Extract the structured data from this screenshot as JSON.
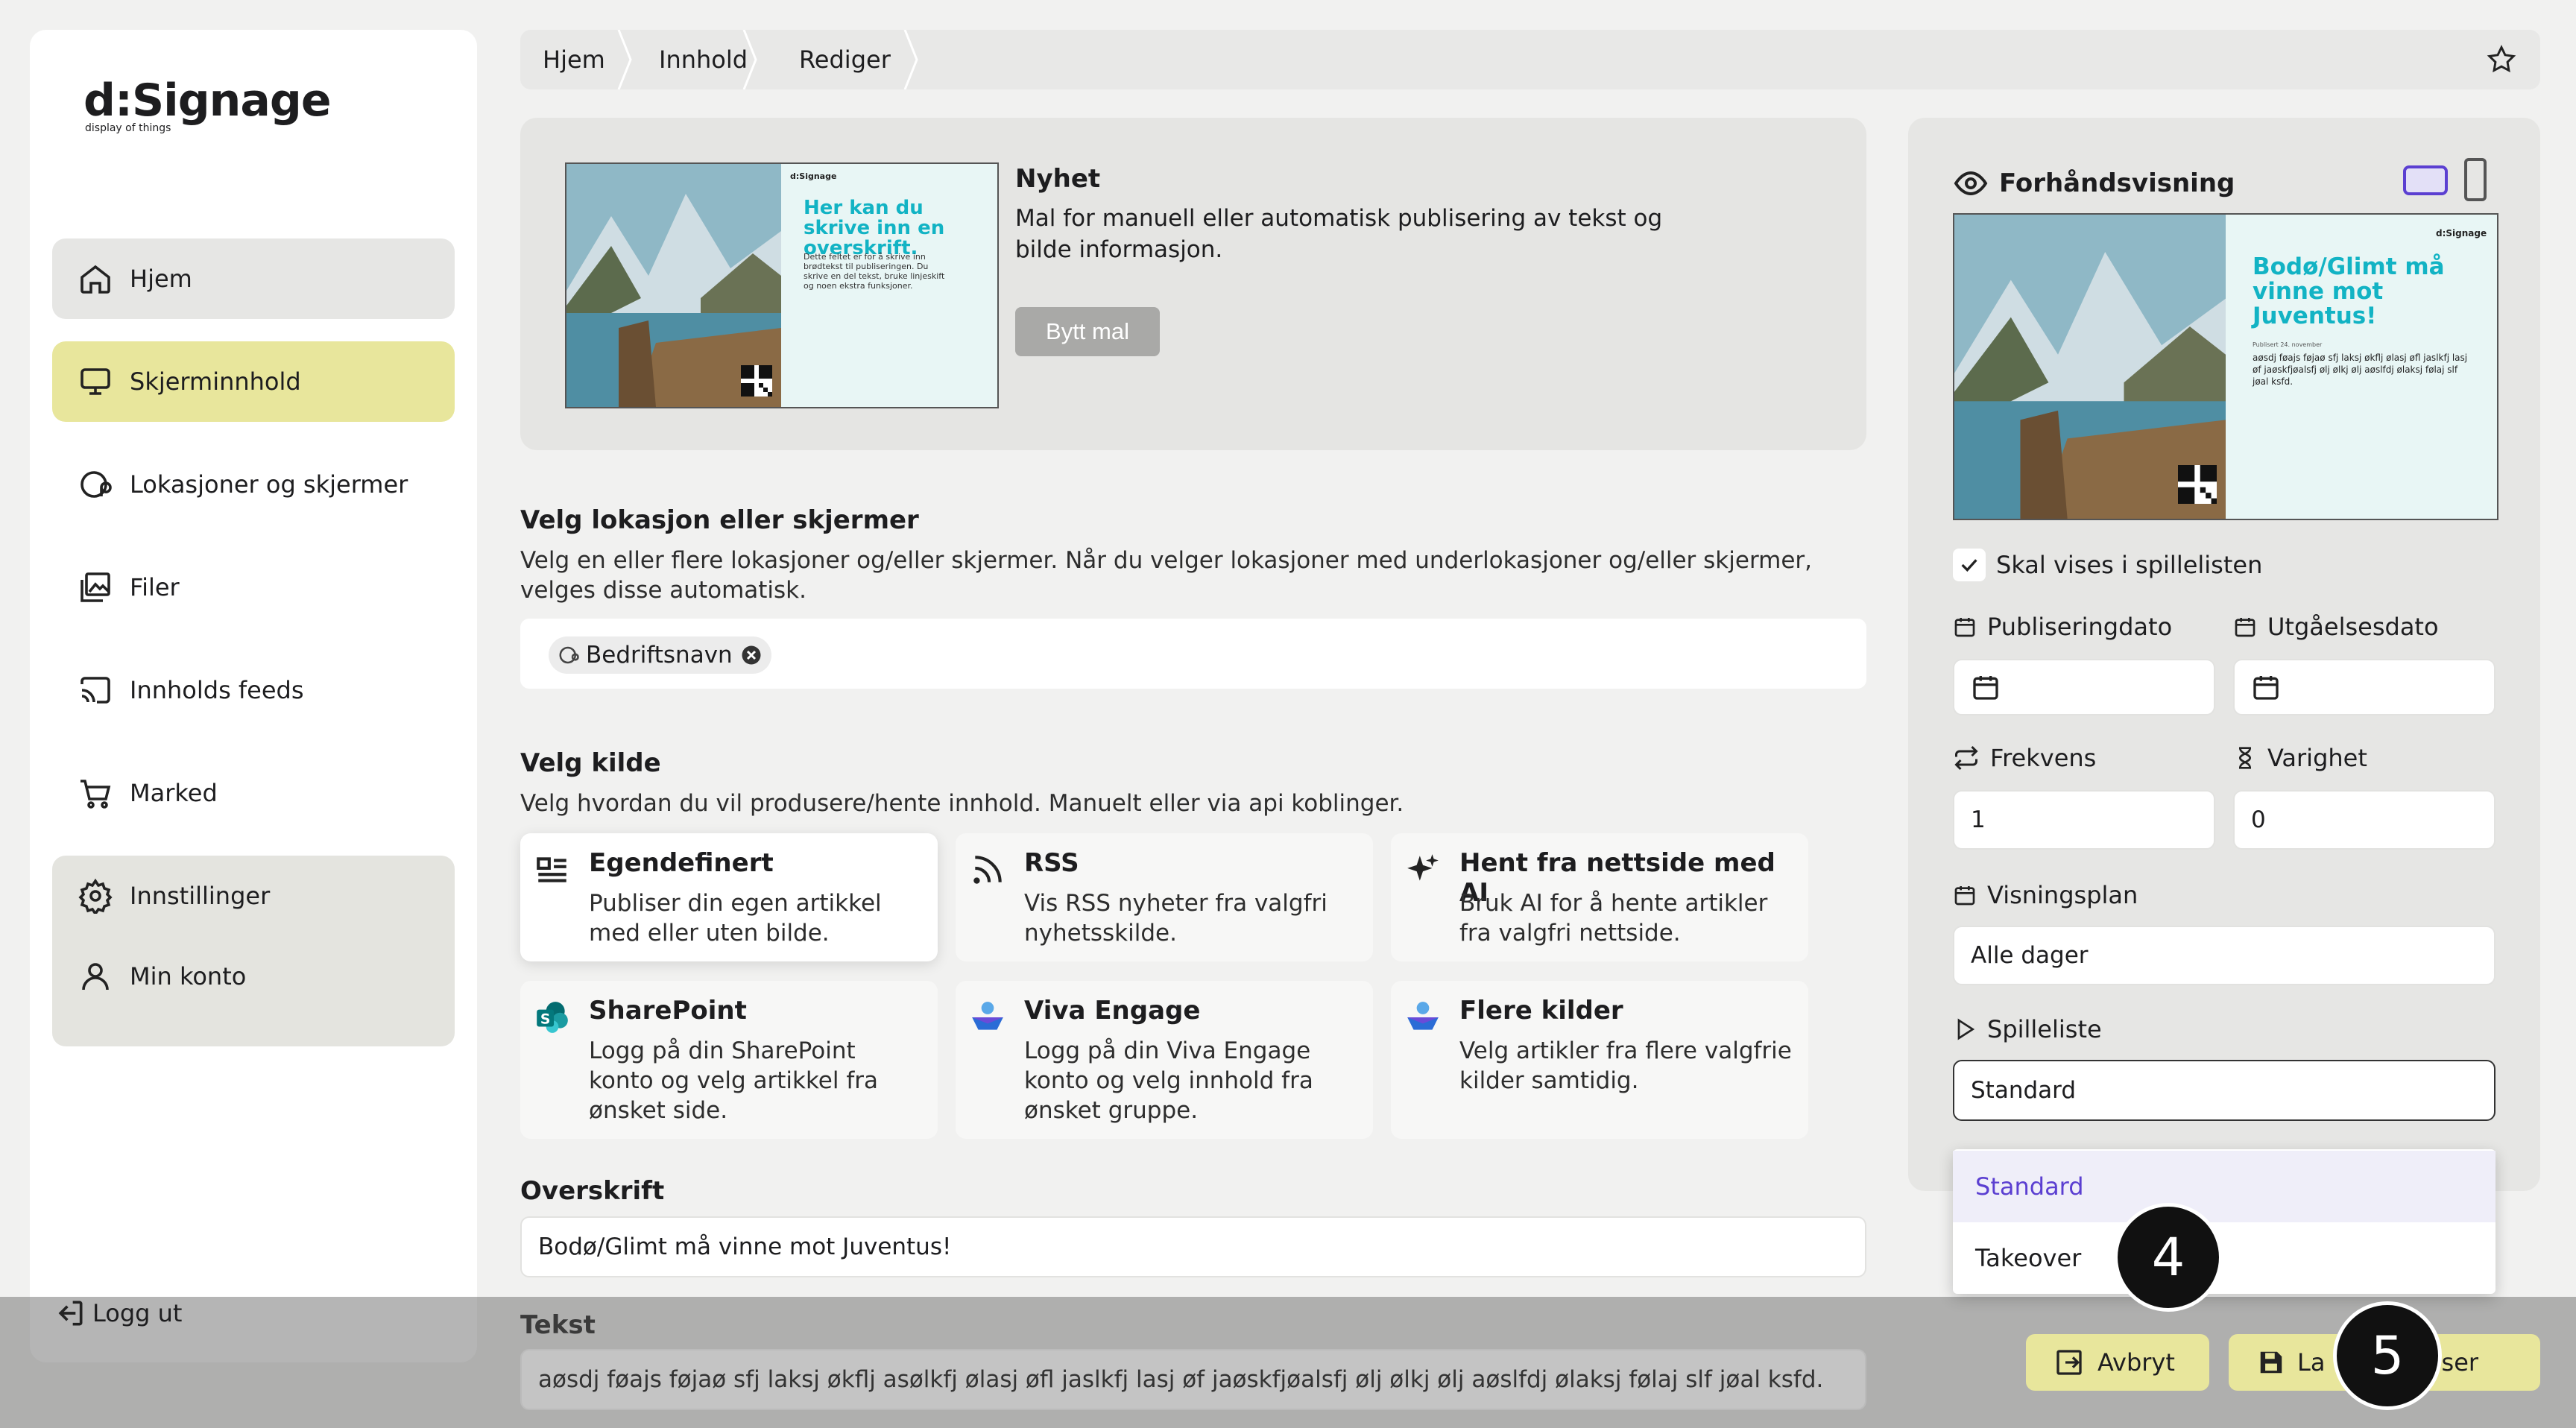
{
  "app": {
    "logo": "d:Signage",
    "logo_sub": "display of things"
  },
  "sidebar": {
    "items": [
      {
        "label": "Hjem",
        "icon": "home-icon"
      },
      {
        "label": "Skjerminnhold",
        "icon": "monitor-icon"
      },
      {
        "label": "Lokasjoner og skjermer",
        "icon": "location-icon"
      },
      {
        "label": "Filer",
        "icon": "images-icon"
      },
      {
        "label": "Innholds feeds",
        "icon": "cast-icon"
      },
      {
        "label": "Marked",
        "icon": "cart-icon"
      },
      {
        "label": "Innstillinger",
        "icon": "gear-icon"
      },
      {
        "label": "Min konto",
        "icon": "user-icon"
      }
    ],
    "logout": "Logg ut"
  },
  "breadcrumb": [
    "Hjem",
    "Innhold",
    "Rediger"
  ],
  "template": {
    "title": "Nyhet",
    "description": "Mal for manuell eller automatisk publisering av tekst og bilde informasjon.",
    "button": "Bytt mal",
    "thumb_heading": "Her kan du skrive inn en overskrift.",
    "thumb_body": "Dette feltet er for å skrive inn brødtekst til publiseringen. Du skrive en del tekst, bruke linjeskift og noen ekstra funksjoner.",
    "thumb_brand": "d:Signage"
  },
  "location": {
    "title": "Velg lokasjon eller skjermer",
    "description": "Velg en eller flere lokasjoner og/eller skjermer. Når du velger lokasjoner med underlokasjoner og/eller skjermer, velges disse automatisk.",
    "chips": [
      "Bedriftsnavn"
    ]
  },
  "source": {
    "title": "Velg kilde",
    "description": "Velg hvordan du vil produsere/hente innhold. Manuelt eller via api koblinger.",
    "cards": [
      {
        "title": "Egendefinert",
        "desc": "Publiser din egen artikkel med eller uten bilde.",
        "icon": "article-icon"
      },
      {
        "title": "RSS",
        "desc": "Vis RSS nyheter fra valgfri nyhetsskilde.",
        "icon": "rss-icon"
      },
      {
        "title": "Hent fra nettside med AI",
        "desc": "Bruk AI for å hente artikler fra valgfri nettside.",
        "icon": "sparkle-icon"
      },
      {
        "title": "SharePoint",
        "desc": "Logg på din SharePoint konto og velg artikkel fra ønsket side.",
        "icon": "sharepoint-icon"
      },
      {
        "title": "Viva Engage",
        "desc": "Logg på din Viva Engage konto og velg innhold fra ønsket gruppe.",
        "icon": "viva-engage-icon"
      },
      {
        "title": "Flere kilder",
        "desc": "Velg artikler fra flere valgfrie kilder samtidig.",
        "icon": "multi-source-icon"
      }
    ]
  },
  "headline": {
    "label": "Overskrift",
    "value": "Bodø/Glimt må vinne mot Juventus!"
  },
  "text": {
    "label": "Tekst",
    "value": "aøsdj føajs føjaø sfj laksj økflj asølkfj ølasj øfl jaslkfj lasj øf jaøskfjøalsfj ølj ølkj ølj aøslfdj ølaksj følaj slf jøal ksfd."
  },
  "preview": {
    "title": "Forhåndsvisning",
    "brand": "d:Signage",
    "heading": "Bodø/Glimt må vinne mot Juventus!",
    "subline": "Publisert 24. november",
    "body": "aøsdj føajs føjaø sfj laksj økflj ølasj øfl jaslkfj lasj øf jaøskfjøalsfj ølj ølkj ølj aøslfdj ølaksj følaj slf jøal ksfd.",
    "show_in_playlist": "Skal vises i spillelisten",
    "show_checked": true,
    "publish_label": "Publiseringdato",
    "expire_label": "Utgåelsesdato",
    "freq_label": "Frekvens",
    "freq_value": "1",
    "duration_label": "Varighet",
    "duration_value": "0",
    "schedule_label": "Visningsplan",
    "schedule_value": "Alle dager",
    "playlist_label": "Spilleliste",
    "playlist_value": "Standard",
    "playlist_options": [
      "Standard",
      "Takeover"
    ]
  },
  "actions": {
    "cancel": "Avbryt",
    "save_publish": "Lagre og publiser",
    "save_visible_left": "La",
    "save_visible_right": "bliser"
  },
  "badges": [
    "4",
    "5"
  ],
  "colors": {
    "accent_yellow": "#e8e69c",
    "purple": "#5b3fd1",
    "teal": "#1fb5c9"
  }
}
